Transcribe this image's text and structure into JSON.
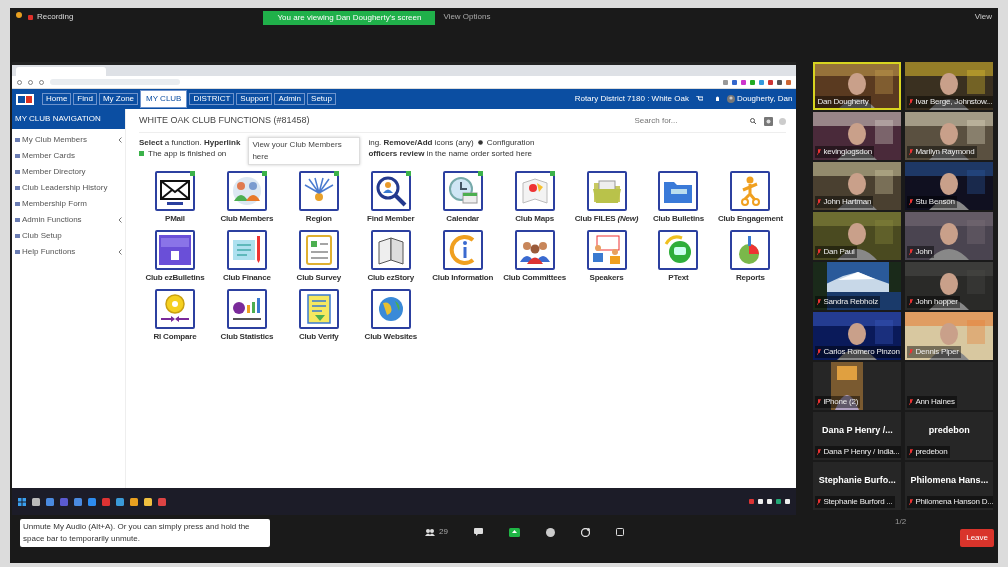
{
  "zoom": {
    "recording": "Recording",
    "banner": "You are viewing Dan Dougherty's screen",
    "view_options": "View Options",
    "view_button": "View"
  },
  "site": {
    "nav_tabs": [
      {
        "label": "Home",
        "selected": false
      },
      {
        "label": "Find",
        "selected": false
      },
      {
        "label": "My Zone",
        "selected": false
      },
      {
        "label": "MY CLUB",
        "selected": true
      },
      {
        "label": "DISTRICT",
        "selected": false
      },
      {
        "label": "Support",
        "selected": false
      },
      {
        "label": "Admin",
        "selected": false
      },
      {
        "label": "Setup",
        "selected": false
      }
    ],
    "district": "Rotary District 7180 : White Oak",
    "user": "Dougherty, Dan"
  },
  "sidebar": {
    "title": "MY CLUB NAVIGATION",
    "items": [
      {
        "label": "My Club Members",
        "expandable": true
      },
      {
        "label": "Member Cards",
        "expandable": false
      },
      {
        "label": "Member Directory",
        "expandable": false
      },
      {
        "label": "Club Leadership History",
        "expandable": false
      },
      {
        "label": "Membership Form",
        "expandable": false
      },
      {
        "label": "Admin Functions",
        "expandable": true
      },
      {
        "label": "Club Setup",
        "expandable": false
      },
      {
        "label": "Help Functions",
        "expandable": true
      }
    ]
  },
  "main": {
    "title": "WHITE OAK CLUB FUNCTIONS (#81458)",
    "search": {
      "placeholder": "Search for..."
    },
    "instructions": [
      "**Select** a function. **Hyperlink**",
      "The app is finished on"
    ],
    "tooltip": "View your Club Members here",
    "notes": [
      "ing. **Remove/Add** icons (any)",
      "**officers review** in the name order sorted here"
    ],
    "configuration": "Configuration",
    "functions": [
      {
        "label": "PMail",
        "pinned": true
      },
      {
        "label": "Club Members",
        "pinned": true
      },
      {
        "label": "Region",
        "pinned": true
      },
      {
        "label": "Find Member",
        "pinned": true
      },
      {
        "label": "Calendar",
        "pinned": true
      },
      {
        "label": "Club Maps",
        "pinned": true
      },
      {
        "label": "Club FILES *(New)*",
        "pinned": false
      },
      {
        "label": "Club Bulletins",
        "pinned": false
      },
      {
        "label": "Club Engagement",
        "pinned": false
      },
      {
        "label": "Club ezBulletins",
        "pinned": false
      },
      {
        "label": "Club Finance",
        "pinned": false
      },
      {
        "label": "Club Survey",
        "pinned": false
      },
      {
        "label": "Club ezStory",
        "pinned": false
      },
      {
        "label": "Club Information",
        "pinned": false
      },
      {
        "label": "Club Committees",
        "pinned": false
      },
      {
        "label": "Speakers",
        "pinned": false
      },
      {
        "label": "PText",
        "pinned": false
      },
      {
        "label": "Reports",
        "pinned": false
      },
      {
        "label": "RI Compare",
        "pinned": false
      },
      {
        "label": "Club Statistics",
        "pinned": false
      },
      {
        "label": "Club Verify",
        "pinned": false
      },
      {
        "label": "Club Websites",
        "pinned": false
      }
    ]
  },
  "participants": [
    {
      "kind": "video",
      "name": "Dan Dougherty",
      "muted": false,
      "active": true
    },
    {
      "kind": "video",
      "name": "Ivar Berge, Johnstow...",
      "muted": true,
      "active": false
    },
    {
      "kind": "video",
      "name": "kevinglogsdon",
      "muted": true,
      "active": false
    },
    {
      "kind": "video",
      "name": "Marilyn Raymond",
      "muted": true,
      "active": false
    },
    {
      "kind": "video",
      "name": "John Hartman",
      "muted": true,
      "active": false
    },
    {
      "kind": "video",
      "name": "Stu Benson",
      "muted": true,
      "active": false
    },
    {
      "kind": "video",
      "name": "Dan Paul",
      "muted": true,
      "active": false
    },
    {
      "kind": "video",
      "name": "John",
      "muted": true,
      "active": false
    },
    {
      "kind": "video",
      "name": "Sandra Rebholz",
      "muted": true,
      "active": false
    },
    {
      "kind": "video",
      "name": "John hopper",
      "muted": true,
      "active": false
    },
    {
      "kind": "video",
      "name": "Carlos Romero Pinzon",
      "muted": true,
      "active": false
    },
    {
      "kind": "video",
      "name": "Dennis Piper",
      "muted": true,
      "active": false
    },
    {
      "kind": "video",
      "name": "iPhone (2)",
      "muted": true,
      "active": false
    },
    {
      "kind": "blank",
      "name": "Ann Haines",
      "muted": true,
      "active": false
    },
    {
      "kind": "name_only",
      "title": "Dana P Henry /...",
      "name": "Dana P Henry / India...",
      "muted": true,
      "active": false
    },
    {
      "kind": "name_only",
      "title": "predebon",
      "name": "predebon",
      "muted": true,
      "active": false
    },
    {
      "kind": "name_only",
      "title": "Stephanie Burfo...",
      "name": "Stephanie Burford ...",
      "muted": true,
      "active": false
    },
    {
      "kind": "name_only",
      "title": "Philomena Hans...",
      "name": "Philomena Hanson D...",
      "muted": true,
      "active": false
    }
  ],
  "pager": "1/2",
  "toolbar": {
    "tooltip": "Unmute My Audio (Alt+A). Or you can simply press and hold the space bar to temporarily unmute.",
    "participants_count": "29",
    "leave": "Leave"
  }
}
